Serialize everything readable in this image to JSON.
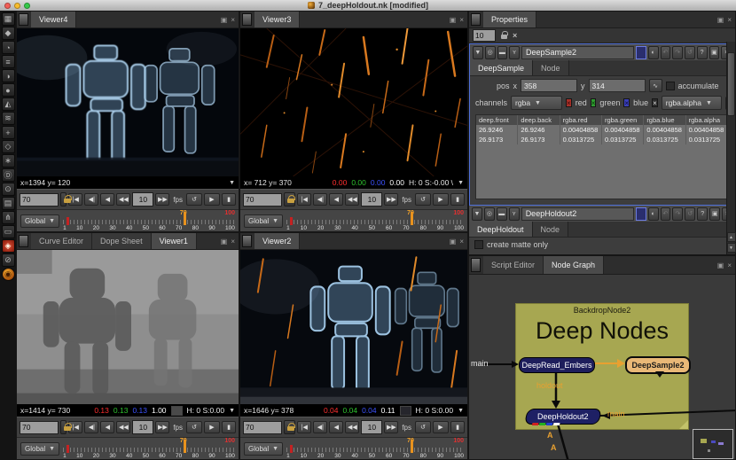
{
  "window": {
    "title": "7_deepHoldout.nk [modified]"
  },
  "glyphs": {
    "caret": "▼",
    "float": "▣",
    "close": "×",
    "help": "?",
    "undo": "↶",
    "redo": "↷",
    "revert": "↺",
    "loop": "↺",
    "play": "▶",
    "wave": "∿",
    "x": "×",
    "collapse": "▼",
    "center": "◎",
    "lowrect": "▬",
    "tree": "ʏ",
    "menu": "≡",
    "up": "▲",
    "down": "▼",
    "half": "◐",
    "bookmark": "▮"
  },
  "left_toolbar": {
    "icons": [
      {
        "label": "▦",
        "name": "image-icon"
      },
      {
        "label": "◆",
        "name": "draw-icon"
      },
      {
        "label": "◔",
        "name": "time-icon"
      },
      {
        "label": "≡",
        "name": "channel-icon"
      },
      {
        "label": "◑",
        "name": "color-icon"
      },
      {
        "label": "●",
        "name": "filter-icon"
      },
      {
        "label": "◭",
        "name": "keyer-icon"
      },
      {
        "label": "≋",
        "name": "merge-icon"
      },
      {
        "label": "+",
        "name": "transform-icon"
      },
      {
        "label": "◇",
        "name": "threed-icon"
      },
      {
        "label": "∗",
        "name": "particles-icon"
      },
      {
        "label": "Ⓓ",
        "name": "deep-icon"
      },
      {
        "label": "⊙",
        "name": "views-icon"
      },
      {
        "label": "▤",
        "name": "metadata-icon"
      },
      {
        "label": "⋔",
        "name": "toolsets-icon"
      },
      {
        "label": "▭",
        "name": "other-icon"
      },
      {
        "label": "◈",
        "name": "plugin-red-icon",
        "cls": "red-bg"
      },
      {
        "label": "⊘",
        "name": "ocula-icon"
      },
      {
        "label": "◉",
        "name": "flame-icon",
        "cls": "orange-bg"
      }
    ]
  },
  "viewers": [
    {
      "tab": "Viewer4",
      "coords": "x=1394 y= 120"
    },
    {
      "tab": "Viewer3",
      "coords": "x= 712 y= 370",
      "r": "0.00",
      "g": "0.00",
      "b": "0.00",
      "a": "0.00",
      "hsv": "H:  0 S:-0.00 \\"
    },
    {
      "tab": "Viewer1",
      "coords": "x=1414 y= 730",
      "r": "0.13",
      "g": "0.13",
      "b": "0.13",
      "a": "1.00",
      "hsv": "H:  0 S:0.00",
      "swatch": "#4a4a4a"
    },
    {
      "tab": "Viewer2",
      "coords": "x=1646 y= 378",
      "r": "0.04",
      "g": "0.04",
      "b": "0.04",
      "a": "0.11",
      "hsv": "H:  0 S:0.00",
      "swatch": "#26262c"
    }
  ],
  "bottom_left_tabs": [
    "Curve Editor",
    "Dope Sheet",
    "Viewer1"
  ],
  "playback": {
    "frame": "70",
    "skip": "10",
    "fps_label": "fps",
    "range": "Global",
    "ticks": [
      "1",
      "10",
      "20",
      "30",
      "40",
      "50",
      "60",
      "70",
      "80",
      "90",
      "100"
    ],
    "playhead": "70",
    "end": "100",
    "transport_back": [
      {
        "label": "|◀",
        "name": "goto-start-button"
      },
      {
        "label": "◀|",
        "name": "prev-keyframe-button"
      },
      {
        "label": "◀",
        "name": "play-backward-button"
      },
      {
        "label": "◀◀",
        "name": "skip-backward-button"
      }
    ],
    "transport_fwd": [
      {
        "label": "▶▶",
        "name": "skip-forward-button"
      }
    ]
  },
  "properties": {
    "tab": "Properties",
    "max_panels": "10",
    "deepsample": {
      "name": "DeepSample2",
      "tab_main": "DeepSample",
      "tab_node": "Node",
      "pos_label": "pos",
      "x_label": "x",
      "x_value": "358",
      "y_label": "y",
      "y_value": "314",
      "accumulate_label": "accumulate",
      "channels_label": "channels",
      "channels_value": "rgba",
      "red_label": "red",
      "green_label": "green",
      "blue_label": "blue",
      "alpha_channel_value": "rgba.alpha",
      "table": {
        "headers": [
          "deep.front",
          "deep.back",
          "rgba.red",
          "rgba.green",
          "rgba.blue",
          "rgba.alpha"
        ],
        "rows": [
          [
            "26.9246",
            "26.9246",
            "0.00404858",
            "0.00404858",
            "0.00404858",
            "0.00404858"
          ],
          [
            "26.9173",
            "26.9173",
            "0.0313725",
            "0.0313725",
            "0.0313725",
            "0.0313725"
          ]
        ]
      }
    },
    "deepholdout": {
      "name": "DeepHoldout2",
      "tab_main": "DeepHoldout",
      "tab_node": "Node",
      "create_matte_label": "create matte only"
    }
  },
  "node_graph": {
    "tab_script": "Script Editor",
    "tab_graph": "Node Graph",
    "backdrop_name": "BackdropNode2",
    "backdrop_title": "Deep Nodes",
    "read_node": "DeepRead_Embers",
    "sample_node": "DeepSample2",
    "holdout_node": "DeepHoldout2",
    "label_main_in": "main",
    "label_holdout": "holdout",
    "label_main_out": "main",
    "label_a": "A"
  },
  "colors": {
    "playhead_orange": "#e8921e",
    "range_red": "#c42222",
    "backdrop": "#a7a751",
    "deep_node_blue": "#1e1e5c",
    "sample_node_tan": "#e9b877",
    "selected_border_blue": "#4f6fd8"
  }
}
